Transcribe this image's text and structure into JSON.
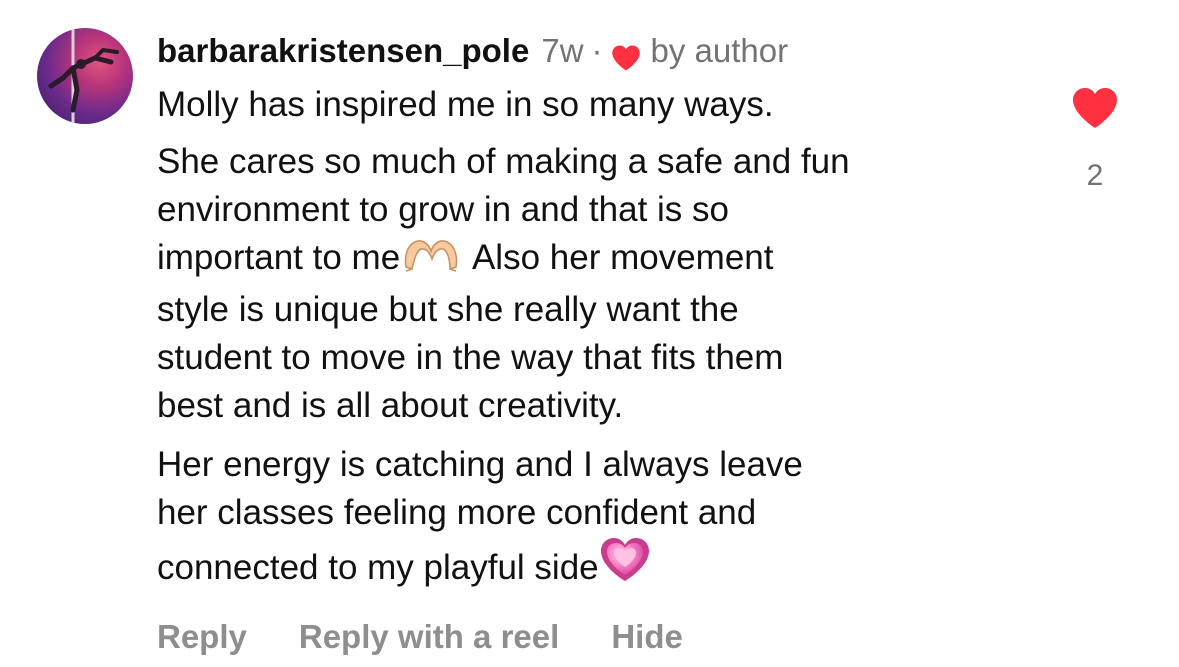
{
  "comment": {
    "username": "barbarakristensen_pole",
    "time_ago": "7w",
    "separator": "·",
    "author_like_label": "by author",
    "paragraphs": [
      {
        "lines": [
          "Molly has inspired me in so many ways."
        ]
      },
      {
        "lines": [
          "She cares so much of making a safe and fun",
          "environment to grow in and that is so",
          "important to me",
          "Also her movement",
          "style is unique but she really want the",
          "student to move in the way that fits them",
          "best and is all about creativity."
        ]
      },
      {
        "lines": [
          "Her energy is catching and I always leave",
          "her classes feeling more confident and",
          "connected to my playful side"
        ]
      }
    ],
    "like_count": "2",
    "actions": {
      "reply": "Reply",
      "reply_with_reel": "Reply with a reel",
      "hide": "Hide"
    },
    "colors": {
      "like_red": "#ff3040",
      "secondary_text": "#737373",
      "action_text": "#8e8e8e"
    },
    "icons": {
      "author_like": "heart-icon",
      "like_button": "heart-filled-icon",
      "emoji_1": "heart-hands-emoji",
      "emoji_2": "growing-heart-emoji"
    }
  }
}
